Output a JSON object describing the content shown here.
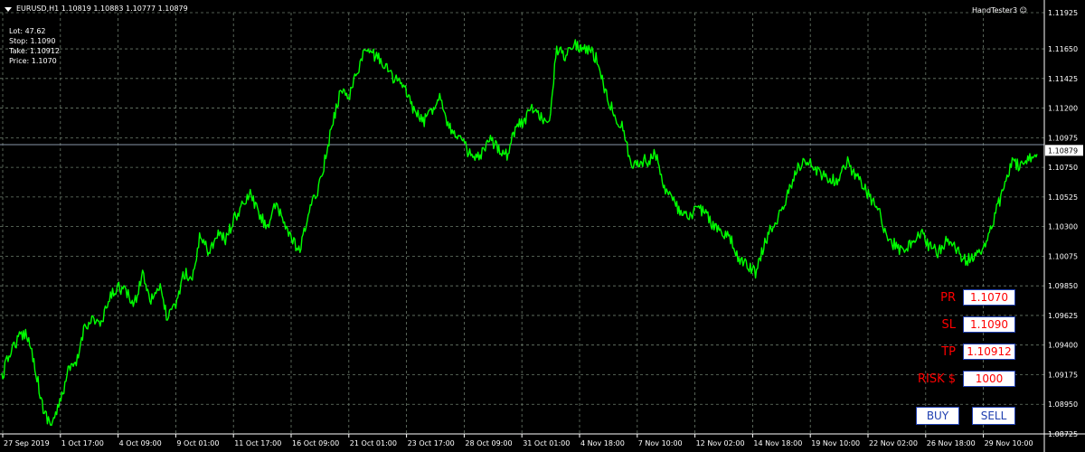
{
  "header": {
    "symbol_line": "EURUSD,H1  1.10819 1.10883 1.10777 1.10879",
    "ea_name": "HandTester3"
  },
  "trade_info": [
    {
      "label": "Lot:",
      "value": "47.62"
    },
    {
      "label": "Stop:",
      "value": "1.1090"
    },
    {
      "label": "Take:",
      "value": "1.10912"
    },
    {
      "label": "Price:",
      "value": "1.1070"
    }
  ],
  "panel": {
    "pr_label": "PR",
    "pr_value": "1.1070",
    "sl_label": "SL",
    "sl_value": "1.1090",
    "tp_label": "TP",
    "tp_value": "1.10912",
    "risk_label": "RISK $",
    "risk_value": "1000",
    "buy_label": "BUY",
    "sell_label": "SELL"
  },
  "colors": {
    "background": "#000000",
    "price_line": "#00ff00",
    "grid": "#6b7b6b",
    "bid_line": "#8896a8",
    "panel_text": "#ff0000",
    "button_border": "#1f3fb0"
  },
  "chart_data": {
    "type": "line",
    "symbol": "EURUSD",
    "timeframe": "H1",
    "ylim": [
      1.08725,
      1.11925
    ],
    "y_ticks": [
      "1.11925",
      "1.11650",
      "1.11425",
      "1.11200",
      "1.10975",
      "1.10879",
      "1.10750",
      "1.10525",
      "1.10300",
      "1.10075",
      "1.09850",
      "1.09625",
      "1.09400",
      "1.09175",
      "1.08950",
      "1.08725"
    ],
    "current_price": "1.10879",
    "x_ticks": [
      "27 Sep 2019",
      "1 Oct 17:00",
      "4 Oct 09:00",
      "9 Oct 01:00",
      "11 Oct 17:00",
      "16 Oct 09:00",
      "21 Oct 01:00",
      "23 Oct 17:00",
      "28 Oct 09:00",
      "31 Oct 01:00",
      "4 Nov 18:00",
      "7 Nov 10:00",
      "12 Nov 02:00",
      "14 Nov 18:00",
      "19 Nov 10:00",
      "22 Nov 02:00",
      "26 Nov 18:00",
      "29 Nov 10:00"
    ],
    "series": [
      {
        "values": [
          1.0915,
          1.0935,
          1.0945,
          1.095,
          1.0925,
          1.089,
          1.088,
          1.0895,
          1.092,
          1.0925,
          1.0955,
          1.096,
          1.0955,
          1.0975,
          1.0985,
          1.098,
          1.097,
          1.0995,
          1.0975,
          1.0985,
          1.096,
          1.097,
          1.0995,
          1.099,
          1.1025,
          1.101,
          1.1025,
          1.102,
          1.1035,
          1.1045,
          1.1055,
          1.104,
          1.103,
          1.1045,
          1.1035,
          1.102,
          1.101,
          1.104,
          1.1055,
          1.108,
          1.111,
          1.1135,
          1.113,
          1.115,
          1.1165,
          1.116,
          1.1155,
          1.1145,
          1.114,
          1.113,
          1.1115,
          1.111,
          1.112,
          1.113,
          1.1105,
          1.11,
          1.109,
          1.108,
          1.1085,
          1.1095,
          1.109,
          1.1085,
          1.1105,
          1.111,
          1.112,
          1.1115,
          1.1105,
          1.1165,
          1.116,
          1.117,
          1.1165,
          1.1165,
          1.1155,
          1.113,
          1.1115,
          1.1105,
          1.1075,
          1.108,
          1.108,
          1.1085,
          1.106,
          1.105,
          1.104,
          1.1035,
          1.1045,
          1.104,
          1.103,
          1.1025,
          1.102,
          1.1005,
          1.1,
          1.0995,
          1.1015,
          1.103,
          1.104,
          1.1055,
          1.1075,
          1.108,
          1.1075,
          1.107,
          1.1065,
          1.1065,
          1.108,
          1.107,
          1.106,
          1.105,
          1.104,
          1.102,
          1.1015,
          1.101,
          1.102,
          1.1025,
          1.1015,
          1.101,
          1.102,
          1.1015,
          1.1005,
          1.1005,
          1.101,
          1.102,
          1.104,
          1.106,
          1.108,
          1.1075,
          1.108,
          1.1085
        ]
      }
    ]
  }
}
